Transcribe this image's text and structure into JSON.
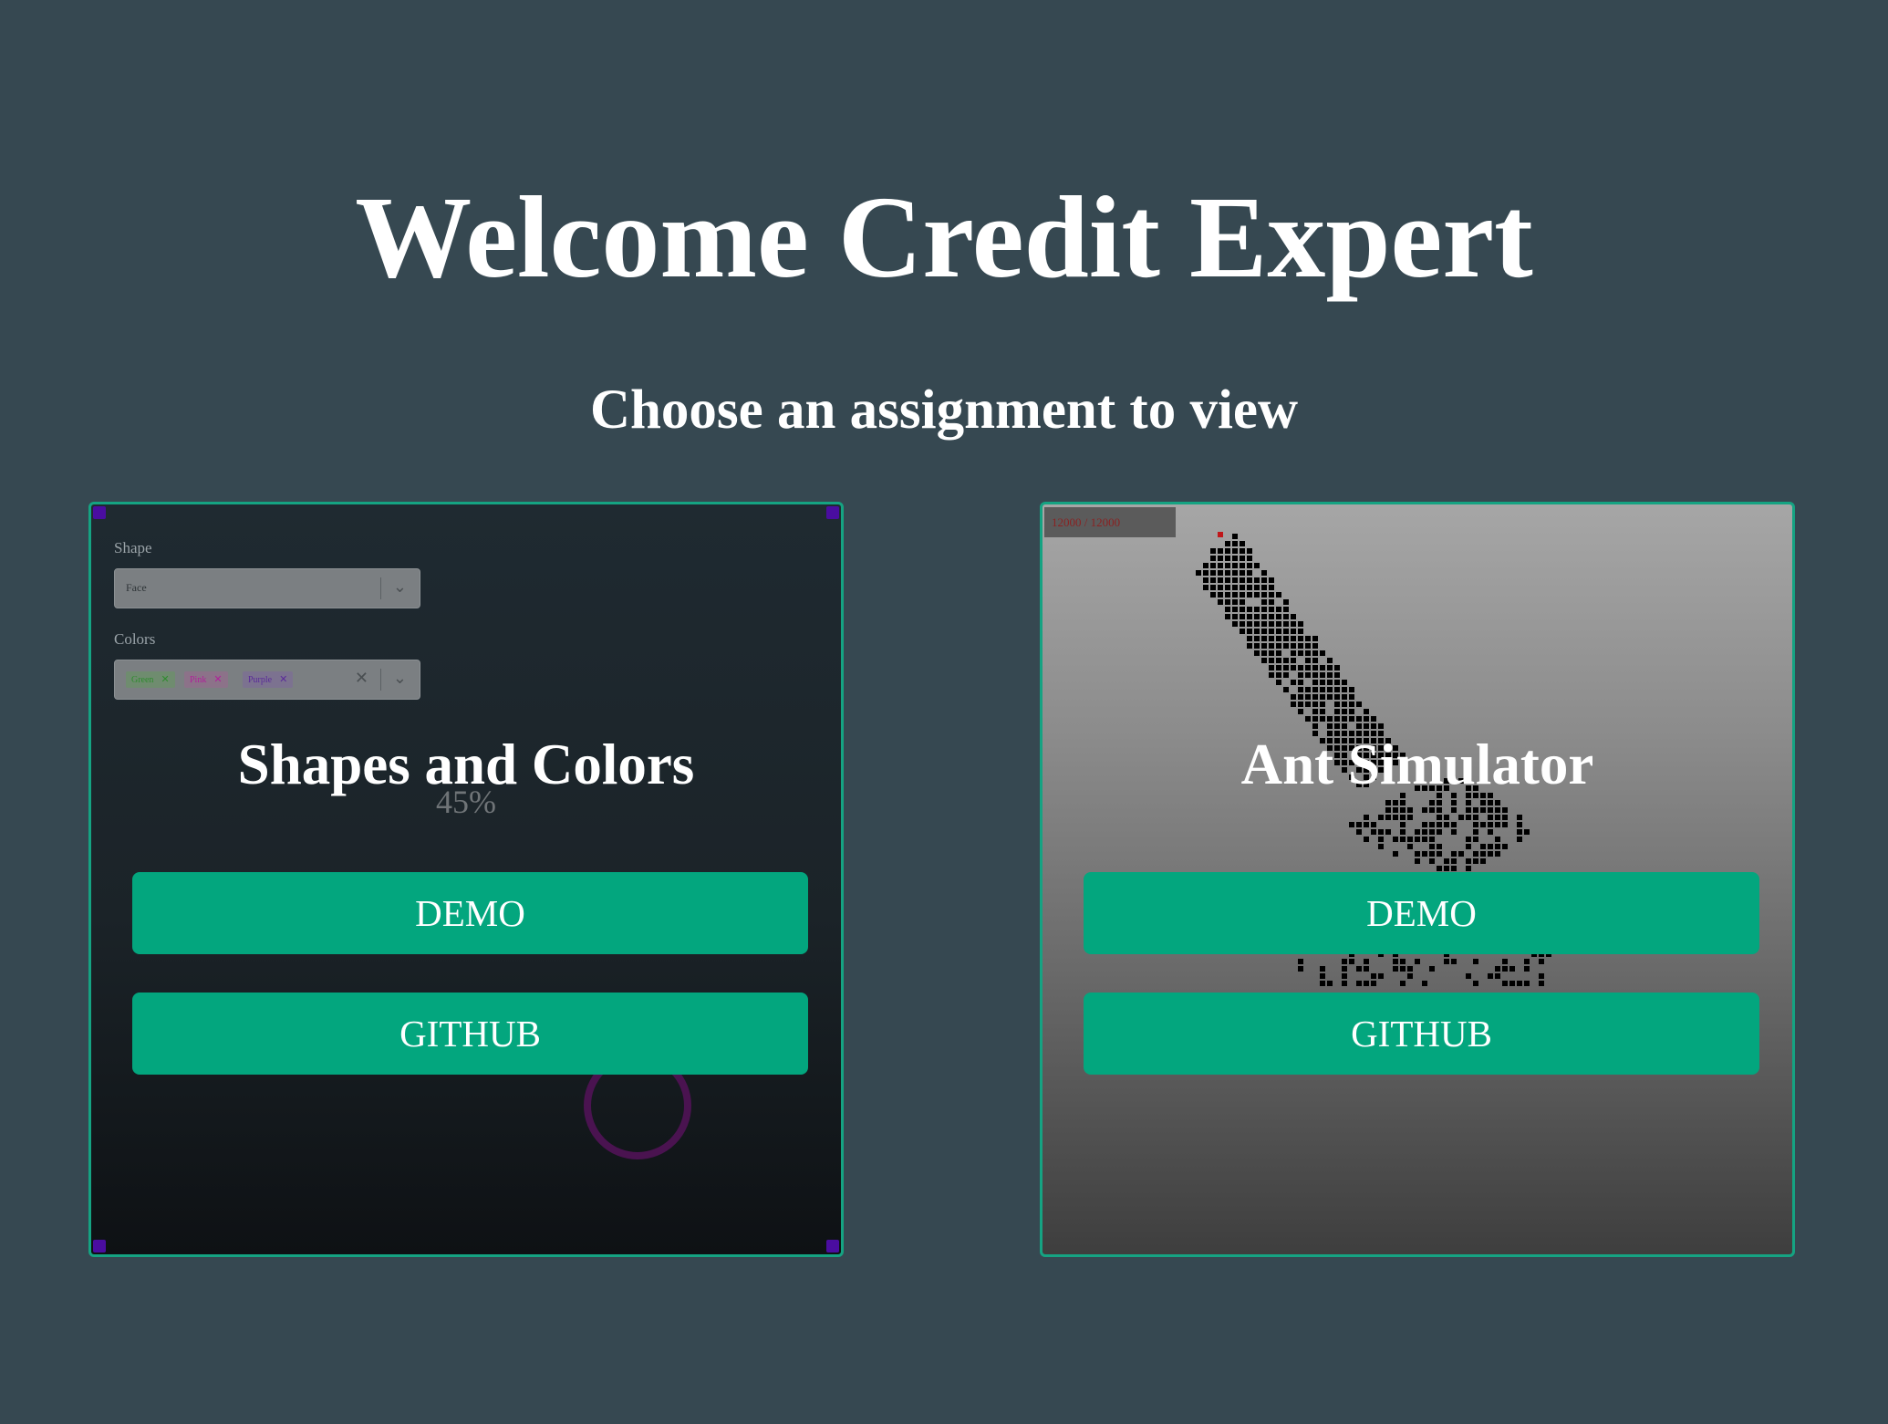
{
  "header": {
    "title": "Welcome Credit Expert",
    "subtitle": "Choose an assignment to view"
  },
  "cards": [
    {
      "title": "Shapes and Colors",
      "demo_label": "DEMO",
      "github_label": "GITHUB",
      "preview": {
        "shape_label": "Shape",
        "shape_value": "Face",
        "colors_label": "Colors",
        "color_tags": [
          {
            "label": "Green",
            "color": "#2e8b2e"
          },
          {
            "label": "Pink",
            "color": "#b0209a"
          },
          {
            "label": "Purple",
            "color": "#5a2a99"
          }
        ],
        "progress": "45%"
      }
    },
    {
      "title": "Ant Simulator",
      "demo_label": "DEMO",
      "github_label": "GITHUB",
      "preview": {
        "counter": "12000 / 12000"
      }
    }
  ],
  "colors": {
    "background": "#364851",
    "accent": "#03a67e",
    "card_border": "#15a382"
  }
}
